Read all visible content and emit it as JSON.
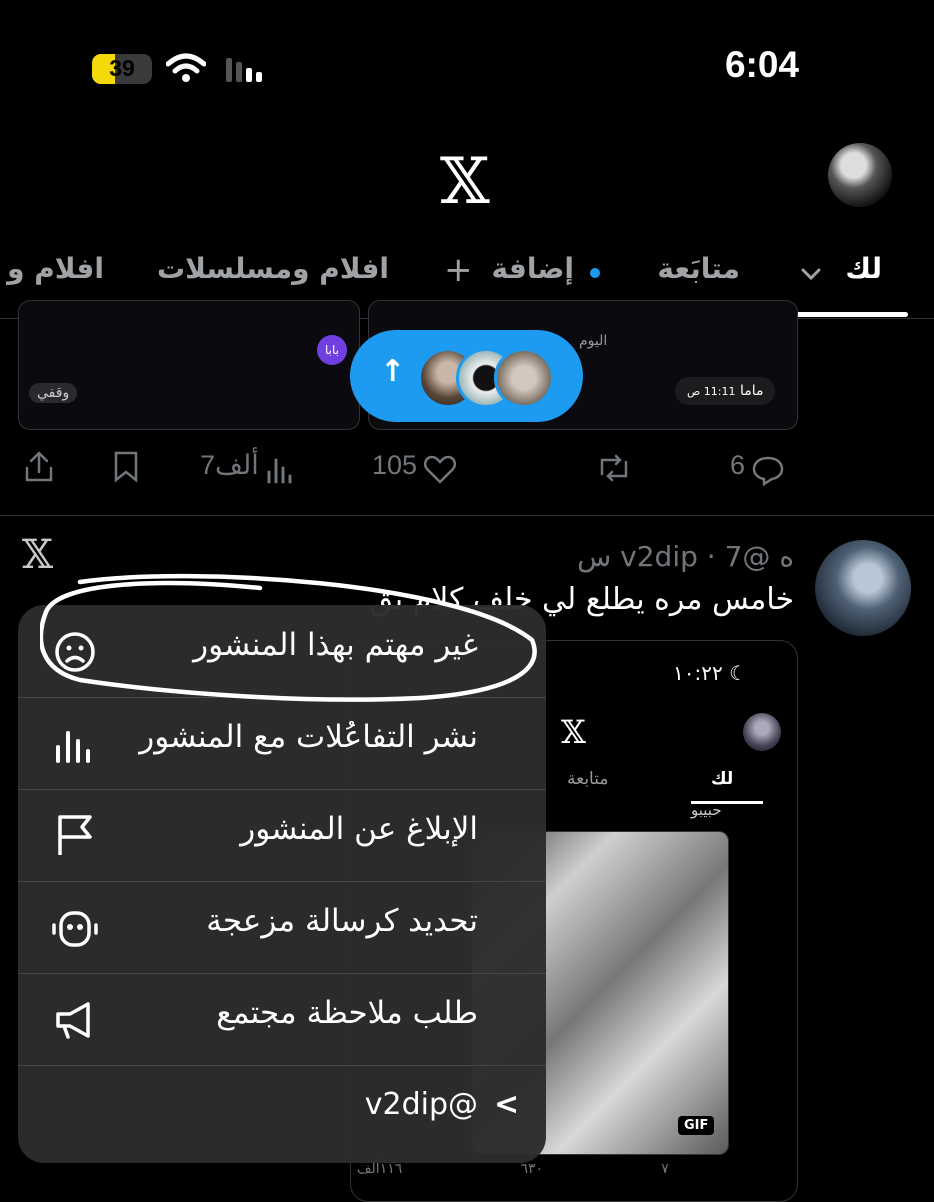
{
  "status_bar": {
    "time": "6:04",
    "battery": "39",
    "battery_level": 0.39
  },
  "header": {
    "logo": "𝕏"
  },
  "tabs": [
    {
      "label": "لك",
      "active": true
    },
    {
      "label": "متابَعة",
      "active": false
    },
    {
      "label": "إضافة",
      "active": false
    },
    {
      "label": "افلام ومسلسلات",
      "active": false
    },
    {
      "label": "افلام و",
      "active": false
    }
  ],
  "prev_tweet": {
    "embed_left_label": "وقفي",
    "embed_left_badge": "بابا",
    "embed_right_title": "اليوم",
    "embed_right_name": "ماما",
    "embed_right_time": "11:11 ص",
    "actions": {
      "replies": "6",
      "reposts": "",
      "likes": "105",
      "views": "7ألف"
    }
  },
  "new_posts_pill": {
    "arrow": "↑"
  },
  "tweet": {
    "more": "ه",
    "handle": "@v2dip",
    "time": "7 س",
    "text": "خامس مره يطلع لي خلف كلام نق",
    "logo": "𝕏",
    "screenshot": {
      "time": "١٠:٢٢",
      "tab_for_you": "لك",
      "tab_following": "متابعة",
      "caption": "حبيبو",
      "gif_label": "GIF",
      "footer": {
        "replies": "",
        "reposts": "٧",
        "likes": "٦٣٠",
        "views": "١١٦ألف"
      }
    }
  },
  "menu": {
    "items": [
      {
        "label": "غير مهتم بهذا المنشور",
        "icon": "sad-face-icon"
      },
      {
        "label": "نشر التفاعُلات مع المنشور",
        "icon": "bar-chart-icon"
      },
      {
        "label": "الإبلاغ عن المنشور",
        "icon": "flag-icon"
      },
      {
        "label": "تحديد كرسالة مزعجة",
        "icon": "robot-icon"
      },
      {
        "label": "طلب ملاحظة مجتمع",
        "icon": "megaphone-icon"
      }
    ],
    "footer": "@v2dip",
    "footer_arrow": "<"
  }
}
